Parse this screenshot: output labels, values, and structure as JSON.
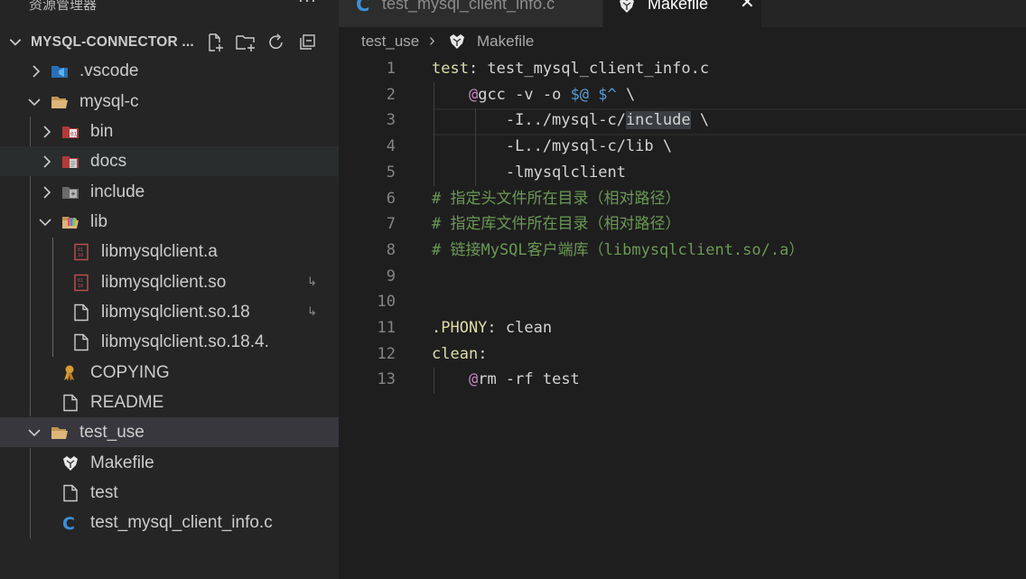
{
  "explorer": {
    "title": "资源管理器",
    "more": "···",
    "section_name": "MYSQL-CONNECTOR ...",
    "actions": [
      "new-file-icon",
      "new-folder-icon",
      "refresh-icon",
      "collapse-all-icon"
    ],
    "items": [
      {
        "label": ".vscode",
        "icon": "vscode-folder-icon",
        "expanded": false
      },
      {
        "label": "mysql-c",
        "icon": "folder-open-icon",
        "expanded": true
      },
      {
        "label": "bin",
        "icon": "bin-folder-icon",
        "expanded": false
      },
      {
        "label": "docs",
        "icon": "docs-folder-icon",
        "expanded": false
      },
      {
        "label": "include",
        "icon": "include-folder-icon",
        "expanded": false
      },
      {
        "label": "lib",
        "icon": "lib-folder-icon",
        "expanded": true
      },
      {
        "label": "libmysqlclient.a",
        "icon": "binary-file-icon"
      },
      {
        "label": "libmysqlclient.so",
        "icon": "binary-file-icon",
        "badge": "↳"
      },
      {
        "label": "libmysqlclient.so.18",
        "icon": "file-icon",
        "badge": "↳"
      },
      {
        "label": "libmysqlclient.so.18.4.",
        "icon": "file-icon"
      },
      {
        "label": "COPYING",
        "icon": "license-icon"
      },
      {
        "label": "README",
        "icon": "file-icon"
      },
      {
        "label": "test_use",
        "icon": "folder-open-icon",
        "expanded": true
      },
      {
        "label": "Makefile",
        "icon": "makefile-icon"
      },
      {
        "label": "test",
        "icon": "file-icon"
      },
      {
        "label": "test_mysql_client_info.c",
        "icon": "c-file-icon"
      }
    ]
  },
  "tabs": [
    {
      "label": "test_mysql_client_info.c",
      "icon": "c-file-icon",
      "active": false
    },
    {
      "label": "Makefile",
      "icon": "makefile-icon",
      "active": true,
      "close": "✕"
    }
  ],
  "breadcrumb": {
    "folder": "test_use",
    "separator": "›",
    "file": "Makefile"
  },
  "editor": {
    "line_numbers": [
      "1",
      "2",
      "3",
      "4",
      "5",
      "6",
      "7",
      "8",
      "9",
      "10",
      "11",
      "12",
      "13"
    ],
    "lines": [
      {
        "tokens": [
          [
            "k-target",
            "test"
          ],
          [
            "k-plain",
            ": test_mysql_client_info.c"
          ]
        ]
      },
      {
        "tokens": [
          [
            "k-plain",
            "    "
          ],
          [
            "k-at",
            "@"
          ],
          [
            "k-plain",
            "gcc -v -o "
          ],
          [
            "k-var",
            "$@"
          ],
          [
            "k-plain",
            " "
          ],
          [
            "k-var",
            "$^"
          ],
          [
            "k-plain",
            " \\"
          ]
        ]
      },
      {
        "tokens": [
          [
            "k-plain",
            "        -I../mysql-c/"
          ],
          [
            "hl",
            "include"
          ],
          [
            "k-plain",
            " \\"
          ]
        ]
      },
      {
        "tokens": [
          [
            "k-plain",
            "        -L../mysql-c/lib \\"
          ]
        ]
      },
      {
        "tokens": [
          [
            "k-plain",
            "        -lmysqlclient"
          ]
        ]
      },
      {
        "tokens": [
          [
            "k-cmt",
            "# 指定头文件所在目录（相对路径）"
          ]
        ]
      },
      {
        "tokens": [
          [
            "k-cmt",
            "# 指定库文件所在目录（相对路径）"
          ]
        ]
      },
      {
        "tokens": [
          [
            "k-cmt",
            "# 链接MySQL客户端库（libmysqlclient.so/.a）"
          ]
        ]
      },
      {
        "tokens": []
      },
      {
        "tokens": []
      },
      {
        "tokens": [
          [
            "k-target",
            ".PHONY"
          ],
          [
            "k-plain",
            ": clean"
          ]
        ]
      },
      {
        "tokens": [
          [
            "k-target",
            "clean"
          ],
          [
            "k-plain",
            ":"
          ]
        ]
      },
      {
        "tokens": [
          [
            "k-plain",
            "    "
          ],
          [
            "k-at",
            "@"
          ],
          [
            "k-plain",
            "rm -rf test"
          ]
        ]
      }
    ]
  },
  "colors": {
    "accent_c": "#3d8fd6",
    "sidebar_bg": "#252526",
    "editor_bg": "#1e1e1e"
  }
}
